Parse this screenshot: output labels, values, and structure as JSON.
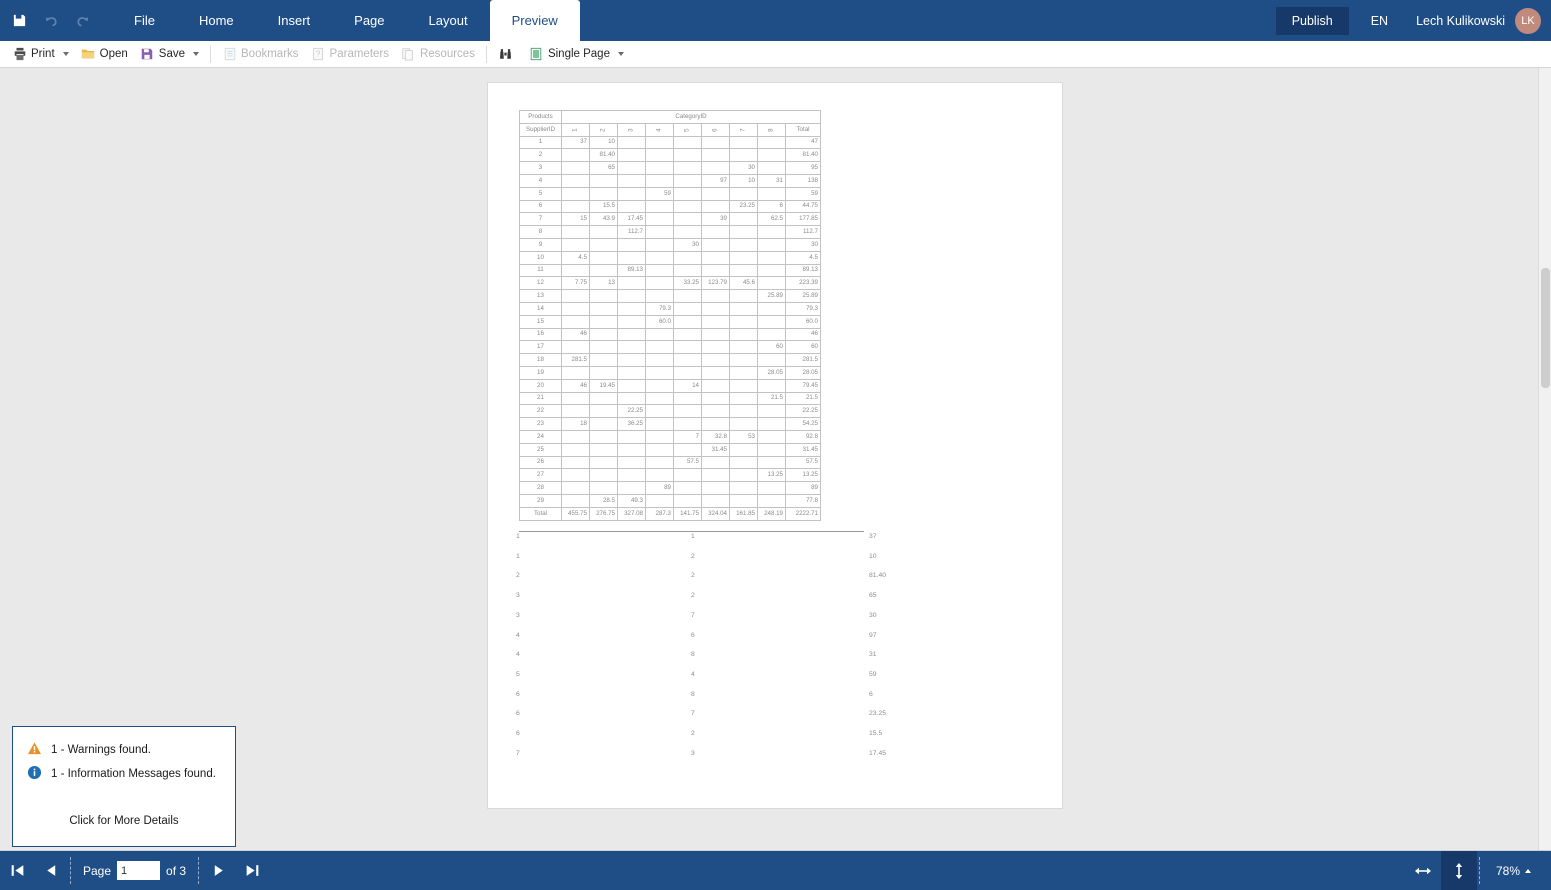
{
  "ribbon": {
    "quick_actions": [
      {
        "name": "save-icon",
        "label": "Save"
      },
      {
        "name": "undo-icon",
        "label": "Undo"
      },
      {
        "name": "redo-icon",
        "label": "Redo"
      }
    ],
    "tabs": [
      {
        "label": "File",
        "active": false
      },
      {
        "label": "Home",
        "active": false
      },
      {
        "label": "Insert",
        "active": false
      },
      {
        "label": "Page",
        "active": false
      },
      {
        "label": "Layout",
        "active": false
      },
      {
        "label": "Preview",
        "active": true
      }
    ],
    "publish_label": "Publish",
    "language_label": "EN",
    "user_name": "Lech Kulikowski",
    "user_initials": "LK",
    "accent_color": "#1f4e87",
    "avatar_color": "#c08a7d"
  },
  "toolbar": {
    "items": [
      {
        "label": "Print",
        "icon": "printer-icon",
        "disabled": false,
        "caret": true
      },
      {
        "label": "Open",
        "icon": "folder-icon",
        "disabled": false,
        "caret": false
      },
      {
        "label": "Save",
        "icon": "floppy-icon",
        "disabled": false,
        "caret": true
      },
      {
        "label": "Bookmarks",
        "icon": "bookmarks-icon",
        "disabled": true,
        "caret": false
      },
      {
        "label": "Parameters",
        "icon": "parameters-icon",
        "disabled": true,
        "caret": false
      },
      {
        "label": "Resources",
        "icon": "resources-icon",
        "disabled": true,
        "caret": false
      },
      {
        "label": "",
        "icon": "binoculars-icon",
        "disabled": false,
        "caret": false
      },
      {
        "label": "Single Page",
        "icon": "single-page-icon",
        "disabled": false,
        "caret": true
      }
    ]
  },
  "report": {
    "crosstab": {
      "corner_top_label": "Products",
      "corner_bottom_label": "SupplierID",
      "column_group_label": "CategoryID",
      "column_headers": [
        "1",
        "2",
        "3",
        "4",
        "5",
        "6",
        "7",
        "8"
      ],
      "total_header": "Total",
      "total_row_label": "Total",
      "rows": [
        {
          "id": "1",
          "cells": [
            "37",
            "10",
            "",
            "",
            "",
            "",
            "",
            ""
          ],
          "total": "47"
        },
        {
          "id": "2",
          "cells": [
            "",
            "81.40",
            "",
            "",
            "",
            "",
            "",
            ""
          ],
          "total": "81.40"
        },
        {
          "id": "3",
          "cells": [
            "",
            "65",
            "",
            "",
            "",
            "",
            "30",
            ""
          ],
          "total": "95"
        },
        {
          "id": "4",
          "cells": [
            "",
            "",
            "",
            "",
            "",
            "97",
            "10",
            "31"
          ],
          "total": "138"
        },
        {
          "id": "5",
          "cells": [
            "",
            "",
            "",
            "59",
            "",
            "",
            "",
            ""
          ],
          "total": "59"
        },
        {
          "id": "6",
          "cells": [
            "",
            "15.5",
            "",
            "",
            "",
            "",
            "23.25",
            "6"
          ],
          "total": "44.75"
        },
        {
          "id": "7",
          "cells": [
            "15",
            "43.9",
            "17.45",
            "",
            "",
            "39",
            "",
            "62.5"
          ],
          "total": "177.85"
        },
        {
          "id": "8",
          "cells": [
            "",
            "",
            "112.7",
            "",
            "",
            "",
            "",
            ""
          ],
          "total": "112.7"
        },
        {
          "id": "9",
          "cells": [
            "",
            "",
            "",
            "",
            "30",
            "",
            "",
            ""
          ],
          "total": "30"
        },
        {
          "id": "10",
          "cells": [
            "4.5",
            "",
            "",
            "",
            "",
            "",
            "",
            ""
          ],
          "total": "4.5"
        },
        {
          "id": "11",
          "cells": [
            "",
            "",
            "89.13",
            "",
            "",
            "",
            "",
            ""
          ],
          "total": "89.13"
        },
        {
          "id": "12",
          "cells": [
            "7.75",
            "13",
            "",
            "",
            "33.25",
            "123.79",
            "45.6",
            ""
          ],
          "total": "223.39"
        },
        {
          "id": "13",
          "cells": [
            "",
            "",
            "",
            "",
            "",
            "",
            "",
            "25.89"
          ],
          "total": "25.89"
        },
        {
          "id": "14",
          "cells": [
            "",
            "",
            "",
            "79.3",
            "",
            "",
            "",
            ""
          ],
          "total": "79.3"
        },
        {
          "id": "15",
          "cells": [
            "",
            "",
            "",
            "60.0",
            "",
            "",
            "",
            ""
          ],
          "total": "60.0"
        },
        {
          "id": "16",
          "cells": [
            "46",
            "",
            "",
            "",
            "",
            "",
            "",
            ""
          ],
          "total": "46"
        },
        {
          "id": "17",
          "cells": [
            "",
            "",
            "",
            "",
            "",
            "",
            "",
            "60"
          ],
          "total": "60"
        },
        {
          "id": "18",
          "cells": [
            "281.5",
            "",
            "",
            "",
            "",
            "",
            "",
            ""
          ],
          "total": "281.5"
        },
        {
          "id": "19",
          "cells": [
            "",
            "",
            "",
            "",
            "",
            "",
            "",
            "28.05"
          ],
          "total": "28.05"
        },
        {
          "id": "20",
          "cells": [
            "46",
            "19.45",
            "",
            "",
            "14",
            "",
            "",
            ""
          ],
          "total": "79.45"
        },
        {
          "id": "21",
          "cells": [
            "",
            "",
            "",
            "",
            "",
            "",
            "",
            "21.5"
          ],
          "total": "21.5"
        },
        {
          "id": "22",
          "cells": [
            "",
            "",
            "22.25",
            "",
            "",
            "",
            "",
            ""
          ],
          "total": "22.25"
        },
        {
          "id": "23",
          "cells": [
            "18",
            "",
            "36.25",
            "",
            "",
            "",
            "",
            ""
          ],
          "total": "54.25"
        },
        {
          "id": "24",
          "cells": [
            "",
            "",
            "",
            "",
            "7",
            "32.8",
            "53",
            ""
          ],
          "total": "92.8"
        },
        {
          "id": "25",
          "cells": [
            "",
            "",
            "",
            "",
            "",
            "31.45",
            "",
            ""
          ],
          "total": "31.45"
        },
        {
          "id": "26",
          "cells": [
            "",
            "",
            "",
            "",
            "57.5",
            "",
            "",
            ""
          ],
          "total": "57.5"
        },
        {
          "id": "27",
          "cells": [
            "",
            "",
            "",
            "",
            "",
            "",
            "",
            "13.25"
          ],
          "total": "13.25"
        },
        {
          "id": "28",
          "cells": [
            "",
            "",
            "",
            "89",
            "",
            "",
            "",
            ""
          ],
          "total": "89"
        },
        {
          "id": "29",
          "cells": [
            "",
            "28.5",
            "49.3",
            "",
            "",
            "",
            "",
            ""
          ],
          "total": "77.8"
        }
      ],
      "totals": [
        "455.75",
        "276.75",
        "327.08",
        "287.3",
        "141.75",
        "324.04",
        "161.85",
        "248.19"
      ],
      "grand_total": "2222.71"
    },
    "detail_list": [
      {
        "supplier": "1",
        "category": "1",
        "value": "37"
      },
      {
        "supplier": "1",
        "category": "2",
        "value": "10"
      },
      {
        "supplier": "2",
        "category": "2",
        "value": "81.40"
      },
      {
        "supplier": "3",
        "category": "2",
        "value": "65"
      },
      {
        "supplier": "3",
        "category": "7",
        "value": "30"
      },
      {
        "supplier": "4",
        "category": "6",
        "value": "97"
      },
      {
        "supplier": "4",
        "category": "8",
        "value": "31"
      },
      {
        "supplier": "5",
        "category": "4",
        "value": "59"
      },
      {
        "supplier": "6",
        "category": "8",
        "value": "6"
      },
      {
        "supplier": "6",
        "category": "7",
        "value": "23.25"
      },
      {
        "supplier": "6",
        "category": "2",
        "value": "15.5"
      },
      {
        "supplier": "7",
        "category": "3",
        "value": "17.45"
      }
    ]
  },
  "messages": {
    "warnings_text": "1 - Warnings found.",
    "info_text": "1 - Information Messages found.",
    "more_details_text": "Click for More Details",
    "warning_color": "#e8912b",
    "info_color": "#1f6fb5"
  },
  "statusbar": {
    "first_label": "First page",
    "prev_label": "Previous page",
    "page_label": "Page",
    "page_value": "1",
    "of_label": "of 3",
    "next_label": "Next page",
    "last_label": "Last page",
    "fit_width_label": "Fit width",
    "fit_page_label": "Fit page",
    "zoom_value": "78%"
  }
}
